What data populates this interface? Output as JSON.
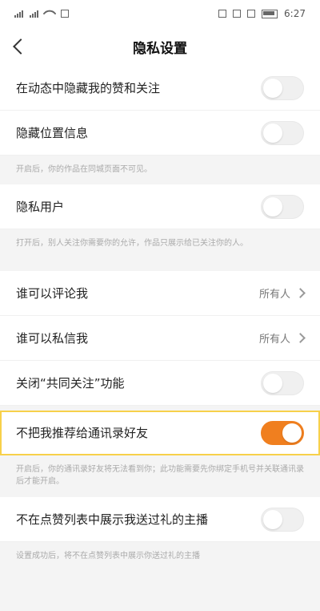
{
  "status": {
    "time": "6:27"
  },
  "header": {
    "title": "隐私设置"
  },
  "rows": [
    {
      "id": "hide-likes",
      "label": "在动态中隐藏我的赞和关注",
      "toggle": false
    },
    {
      "id": "hide-location",
      "label": "隐藏位置信息",
      "toggle": false
    },
    {
      "id": "note-location",
      "text": "开启后，你的作品在同城页面不可见。"
    },
    {
      "id": "private-user",
      "label": "隐私用户",
      "toggle": false
    },
    {
      "id": "note-private",
      "text": "打开后，别人关注你需要你的允许，作品只展示给已关注你的人。"
    },
    {
      "id": "who-comment",
      "label": "谁可以评论我",
      "value": "所有人"
    },
    {
      "id": "who-message",
      "label": "谁可以私信我",
      "value": "所有人"
    },
    {
      "id": "close-common-follow",
      "label": "关闭“共同关注”功能",
      "toggle": false
    },
    {
      "id": "no-recommend-contacts",
      "label": "不把我推荐给通讯录好友",
      "toggle": true
    },
    {
      "id": "note-contacts",
      "text": "开启后，你的通讯录好友将无法看到你；此功能需要先你绑定手机号并关联通讯录后才能开启。"
    },
    {
      "id": "hide-gift-list",
      "label": "不在点赞列表中展示我送过礼的主播",
      "toggle": false
    },
    {
      "id": "note-gift",
      "text": "设置成功后，将不在点赞列表中展示你送过礼的主播"
    }
  ],
  "colors": {
    "accent": "#f07f1f",
    "highlight": "#f7d04a"
  }
}
